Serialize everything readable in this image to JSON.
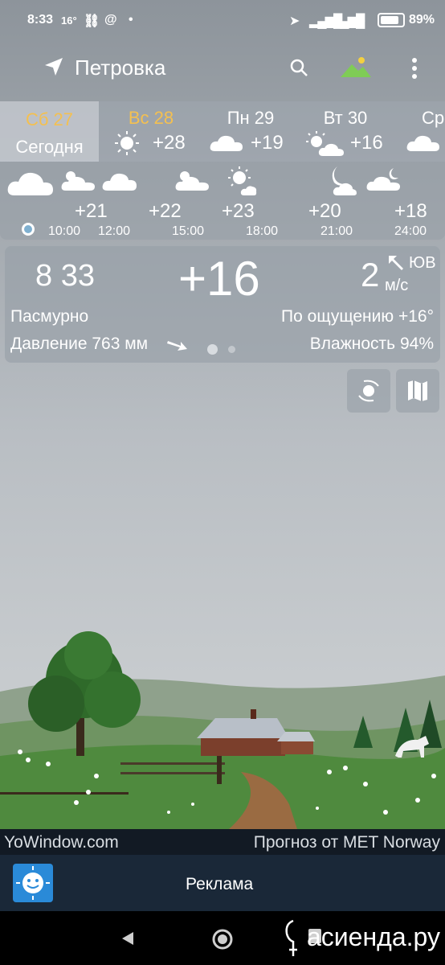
{
  "status": {
    "time": "8:33",
    "temp": "16°",
    "signal": "@",
    "battery": "89%"
  },
  "header": {
    "city": "Петровка"
  },
  "days": [
    {
      "name": "Сб 27",
      "sub": "Сегодня",
      "temp": ""
    },
    {
      "name": "Вс 28",
      "sub": "",
      "temp": "+28"
    },
    {
      "name": "Пн 29",
      "sub": "",
      "temp": "+19"
    },
    {
      "name": "Вт 30",
      "sub": "",
      "temp": "+16"
    },
    {
      "name": "Ср",
      "sub": "",
      "temp": ""
    }
  ],
  "hourly": {
    "temps": [
      "+21",
      "+22",
      "+23",
      "+20",
      "+18"
    ],
    "times": [
      "10:00",
      "12:00",
      "15:00",
      "18:00",
      "21:00",
      "24:00"
    ]
  },
  "current": {
    "time": "8 33",
    "temp": "+16",
    "wind_speed": "2",
    "wind_unit": "м/с",
    "wind_dir": "ЮВ",
    "condition": "Пасмурно",
    "feels_like": "По ощущению +16°",
    "pressure": "Давление 763 мм",
    "humidity": "Влажность 94%"
  },
  "footer": {
    "left": "YoWindow.com",
    "right": "Прогноз от MET Norway"
  },
  "ad": {
    "label": "Реклама"
  },
  "watermark": "асиенда.ру",
  "colors": {
    "today_label": "#f4c050",
    "footer_bg": "#121a24",
    "ad_bg": "#1a2838"
  }
}
